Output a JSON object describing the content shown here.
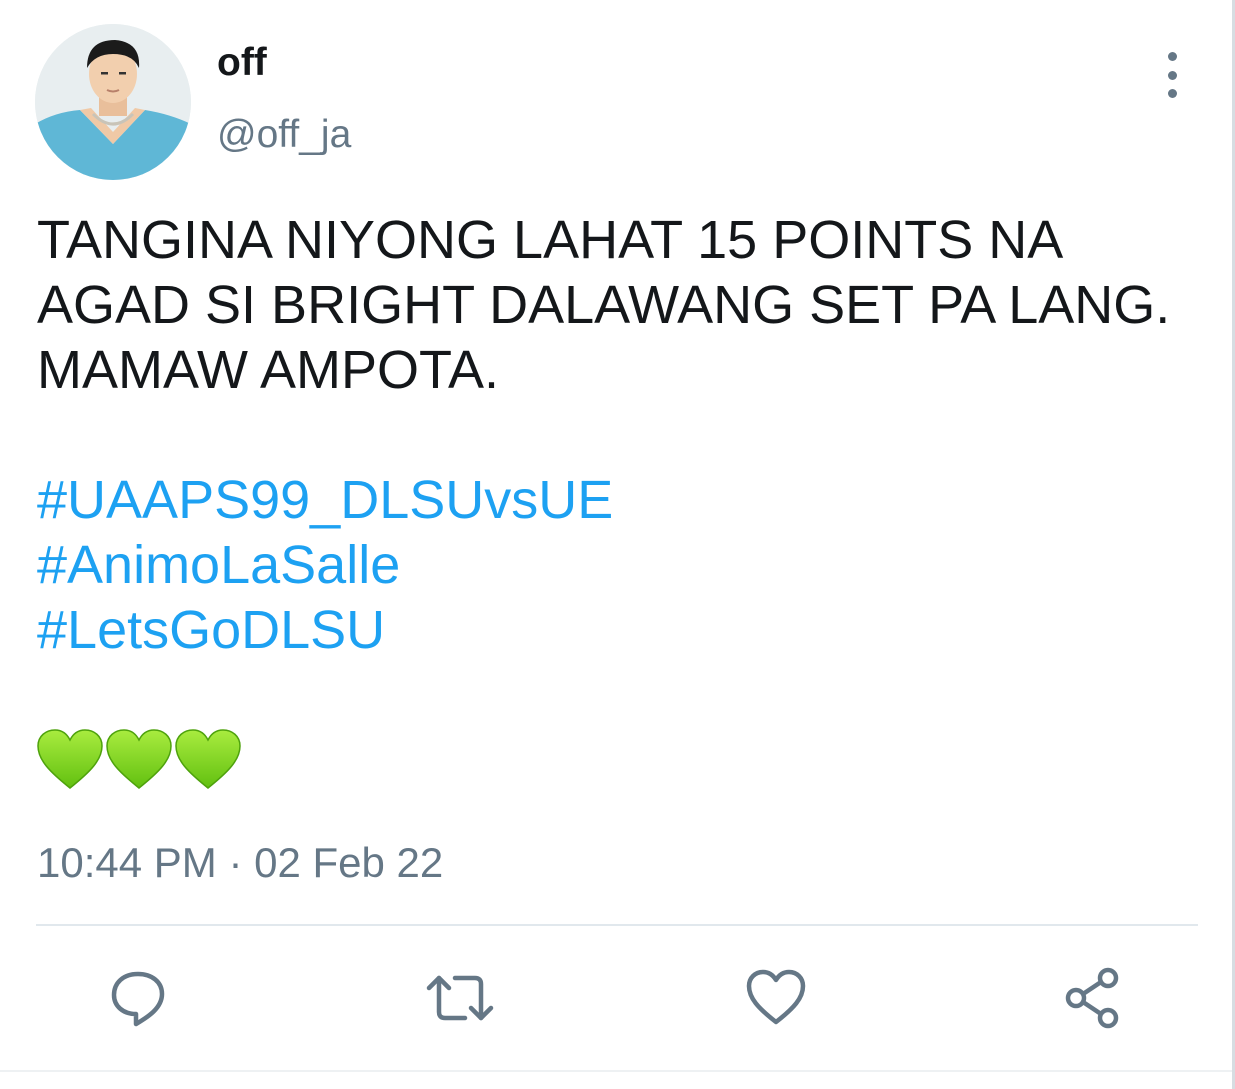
{
  "author": {
    "display_name": "off",
    "handle": "@off_ja"
  },
  "tweet": {
    "text": "TANGINA NIYONG LAHAT 15 POINTS NA AGAD SI BRIGHT DALAWANG SET PA LANG. MAMAW AMPOTA.",
    "hashtags": [
      "#UAAPS99_DLSUvsUE",
      "#AnimoLaSalle",
      "#LetsGoDLSU"
    ],
    "emoji": [
      "green-heart",
      "green-heart",
      "green-heart"
    ],
    "timestamp": "10:44 PM · 02 Feb 22"
  },
  "actions": [
    {
      "name": "reply",
      "icon": "reply-icon"
    },
    {
      "name": "retweet",
      "icon": "retweet-icon"
    },
    {
      "name": "like",
      "icon": "heart-icon"
    },
    {
      "name": "share",
      "icon": "share-icon"
    }
  ],
  "colors": {
    "text": "#14171a",
    "secondary": "#657786",
    "link": "#1da1f2",
    "divider": "#e1e8ed",
    "heart_green": "#7ed321"
  }
}
